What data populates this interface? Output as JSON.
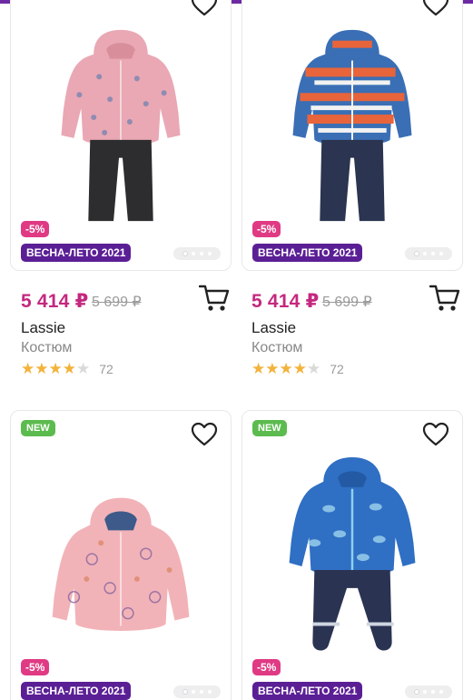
{
  "colors": {
    "accent_purple": "#5b1f95",
    "price_pink": "#c4287f",
    "discount_pink": "#e03a84",
    "new_green": "#5cbb4e",
    "star_gold": "#f3b23a"
  },
  "products": [
    {
      "badge_new": "",
      "discount": "-5%",
      "season": "ВЕСНА-ЛЕТО 2021",
      "price": "5 414 ₽",
      "old_price": "5 699 ₽",
      "brand": "Lassie",
      "type": "Костюм",
      "rating": 4,
      "reviews": "72",
      "image": "pink-bird-print-jacket-black-pants"
    },
    {
      "badge_new": "",
      "discount": "-5%",
      "season": "ВЕСНА-ЛЕТО 2021",
      "price": "5 414 ₽",
      "old_price": "5 699 ₽",
      "brand": "Lassie",
      "type": "Костюм",
      "rating": 4,
      "reviews": "72",
      "image": "blue-orange-print-jacket-navy-pants"
    },
    {
      "badge_new": "NEW",
      "discount": "-5%",
      "season": "ВЕСНА-ЛЕТО 2021",
      "image": "pink-animal-print-jacket"
    },
    {
      "badge_new": "NEW",
      "discount": "-5%",
      "season": "ВЕСНА-ЛЕТО 2021",
      "image": "blue-animal-print-jacket-navy-pants"
    }
  ],
  "icons": {
    "favorite": "heart-outline-icon",
    "cart": "shopping-cart-icon",
    "rating": "star-icon"
  }
}
